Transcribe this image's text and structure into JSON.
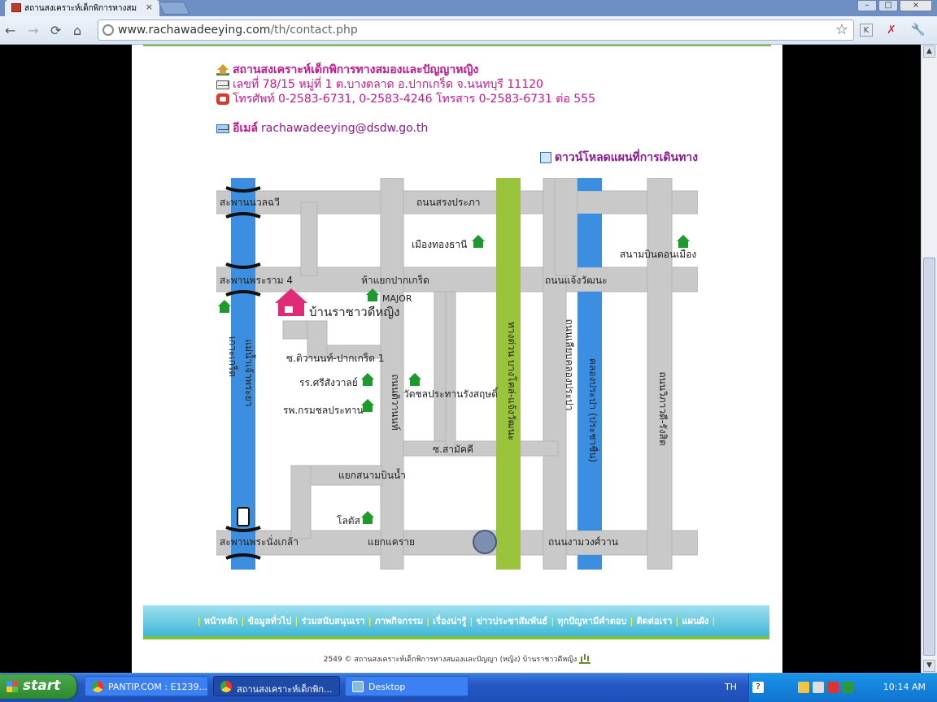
{
  "browser": {
    "tab_title": "สถานสงเคราะห์เด็กพิการทางสม",
    "url_domain": "www.rachawadeeying.com",
    "url_path": "/th/contact.php"
  },
  "contact": {
    "name": "สถานสงเคราะห์เด็กพิการทางสมองและปัญญาหญิง",
    "address": "เลขที่ 78/15 หมู่ที่ 1 ต.บางตลาด อ.ปากเกร็ด จ.นนทบุรี 11120",
    "phone": "โทรศัพท์ 0-2583-6731, 0-2583-4246 โทรสาร 0-2583-6731 ต่อ 555",
    "email_label": "อีเมล์",
    "email": "rachawadeeying@dsdw.go.th"
  },
  "download_label": "ดาวน์โหลดแผนที่การเดินทาง",
  "map": {
    "labels": {
      "bridge_top": "สะพานนวลฉวี",
      "road_top": "ถนนสรงประภา",
      "mueang_thong": "เมืองทองธานี",
      "airport": "สนามบินดอนเมือง",
      "bridge_rama4": "สะพานพระราม 4",
      "pakkret_junction": "ห้าแยกปากเกร็ด",
      "chaengwattana": "ถนนแจ้งวัฒนะ",
      "major": "MAJOR",
      "home": "บ้านราชาวดีหญิง",
      "ko_kret": "เกาะเกร็ด",
      "river": "แม่น้ำเจ้าพระยา",
      "soi_tiwanon": "ซ.ติวานนท์-ปากเกร็ด 1",
      "school": "รร.ศรีสังวาลย์",
      "wat": "วัดชลประทานรังสฤษดิ์",
      "tiwanon_road": "ถนนติวานนท์",
      "hospital": "รพ.กรมชลประทาน",
      "expressway": "ทางด่วน บางโคล่-แจ้งวัฒนะ",
      "prapa_road": "ถนนเลียบคลองประปา",
      "canal": "คลองประปา (ประชาชื่น)",
      "vibhavadi": "ถนนวิภาวดี-รังสิต",
      "soi_samakkhi": "ซ.สามัคคี",
      "sanambinnam": "แยกสนามบินน้ำ",
      "lotus": "โลตัส",
      "bridge_bottom": "สะพานพระนั่งเกล้า",
      "khae_rai": "แยกแคราย",
      "ngamwongwan": "ถนนงามวงศ์วาน"
    }
  },
  "footer": {
    "links": [
      "หน้าหลัก",
      "ข้อมูลทั่วไป",
      "ร่วมสนับสนุนเรา",
      "ภาพกิจกรรม",
      "เรื่องน่ารู้",
      "ข่าวประชาสัมพันธ์",
      "ทุกปัญหามีคำตอบ",
      "ติดต่อเรา",
      "แผนผัง"
    ],
    "copyright": "2549 © สถานสงเคราะห์เด็กพิการทางสมองและปัญญา (หญิง) บ้านราชาวดีหญิง"
  },
  "taskbar": {
    "start": "start",
    "tasks": [
      "PANTIP.COM : E1239...",
      "สถานสงเคราะห์เด็กพิก...",
      "Desktop"
    ],
    "lang": "TH",
    "time": "10:14 AM"
  }
}
